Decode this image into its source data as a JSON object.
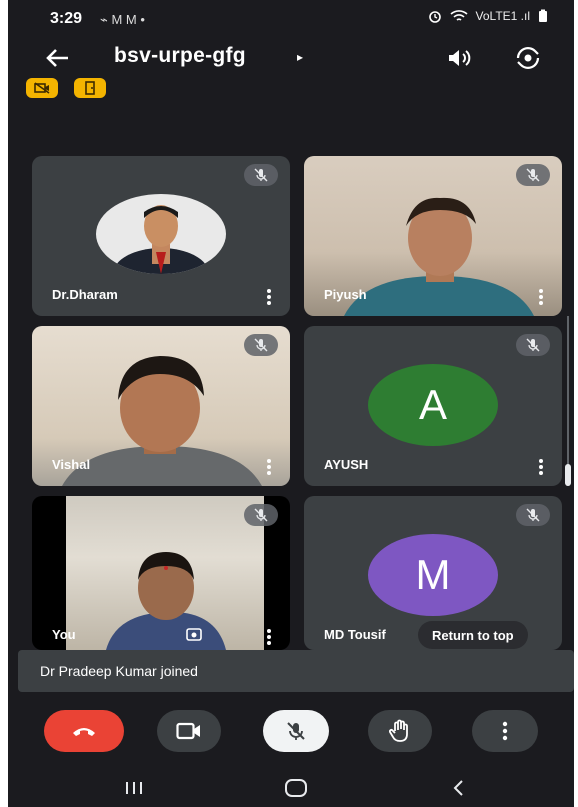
{
  "status_bar": {
    "time": "3:29",
    "notifications": "⌁ M M •",
    "network": "VoLTE1 .ıl"
  },
  "header": {
    "meeting_code": "bsv-urpe-gfg"
  },
  "participants": [
    {
      "name": "Dr.Dharam",
      "type": "photo-avatar",
      "muted": true
    },
    {
      "name": "Piyush",
      "type": "video",
      "muted": true
    },
    {
      "name": "Vishal",
      "type": "video",
      "muted": true
    },
    {
      "name": "AYUSH",
      "type": "letter-avatar",
      "letter": "A",
      "color": "#2e7d32",
      "muted": true
    },
    {
      "name": "You",
      "type": "video",
      "muted": true
    },
    {
      "name": "MD Tousif",
      "type": "letter-avatar",
      "letter": "M",
      "color": "#7e57c2",
      "muted": true
    }
  ],
  "return_to_top_label": "Return to top",
  "toast_message": "Dr Pradeep Kumar joined",
  "colors": {
    "background": "#1b1b1f",
    "tile": "#3c4043",
    "end_call": "#ea4335",
    "badge": "#f4b400"
  },
  "icons": [
    "back-arrow-icon",
    "speaker-icon",
    "switch-camera-icon",
    "camera-off-badge-icon",
    "door-badge-icon",
    "mic-off-icon",
    "more-vert-icon",
    "end-call-icon",
    "camera-icon",
    "raise-hand-icon",
    "recents-icon",
    "home-icon",
    "back-nav-icon"
  ]
}
